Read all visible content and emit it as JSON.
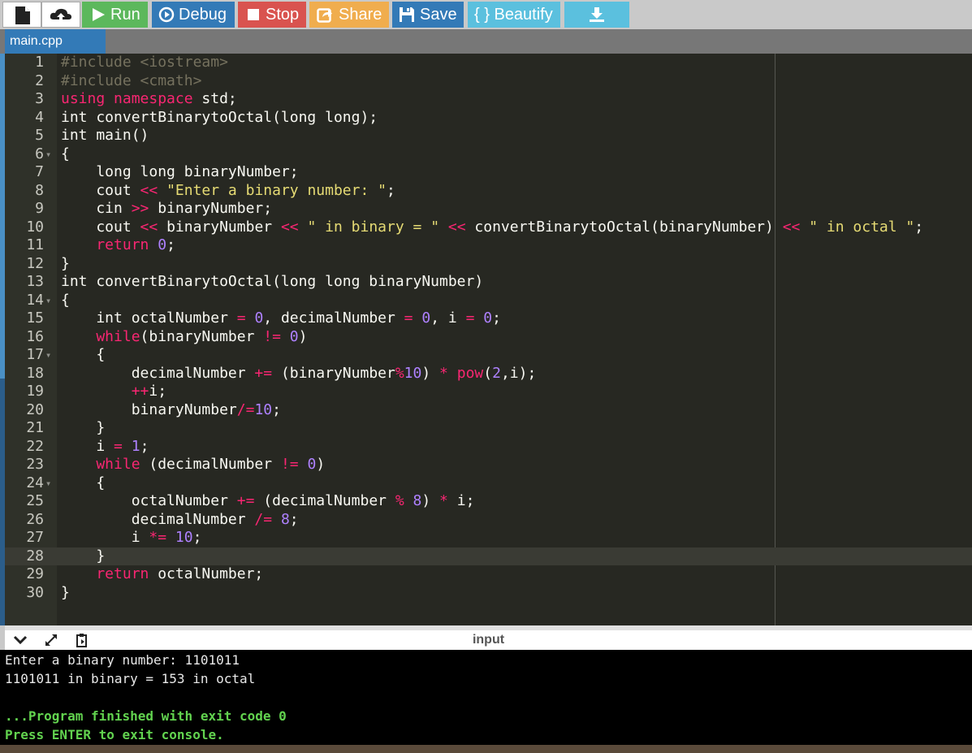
{
  "toolbar": {
    "buttons": [
      {
        "label": "Run",
        "icon": "play-icon",
        "color": "#5cb85c"
      },
      {
        "label": "Debug",
        "icon": "debug-circle-icon",
        "color": "#337ab7"
      },
      {
        "label": "Stop",
        "icon": "stop-square-icon",
        "color": "#d9534f"
      },
      {
        "label": "Share",
        "icon": "share-icon",
        "color": "#f0ad4e"
      },
      {
        "label": "Save",
        "icon": "floppy-disk-icon",
        "color": "#337ab7"
      },
      {
        "label": "{ } Beautify",
        "icon": "braces-icon",
        "color": "#5bc0de"
      },
      {
        "label": "",
        "icon": "download-icon",
        "color": "#5bc0de"
      }
    ]
  },
  "tab": {
    "label": "main.cpp"
  },
  "editor": {
    "active_line": 28,
    "lines": [
      {
        "n": "1",
        "fold": "",
        "parts": [
          [
            "inc",
            "#include "
          ],
          [
            "incf",
            "<iostream>"
          ]
        ]
      },
      {
        "n": "2",
        "fold": "",
        "parts": [
          [
            "inc",
            "#include "
          ],
          [
            "incf",
            "<cmath>"
          ]
        ]
      },
      {
        "n": "3",
        "fold": "",
        "parts": [
          [
            "ctl",
            "using namespace"
          ],
          [
            "kw",
            " std;"
          ]
        ]
      },
      {
        "n": "4",
        "fold": "",
        "parts": [
          [
            "kw",
            "int convertBinarytoOctal(long long);"
          ]
        ]
      },
      {
        "n": "5",
        "fold": "",
        "parts": [
          [
            "kw",
            "int main()"
          ]
        ]
      },
      {
        "n": "6",
        "fold": "▾",
        "parts": [
          [
            "kw",
            "{"
          ]
        ]
      },
      {
        "n": "7",
        "fold": "",
        "parts": [
          [
            "kw",
            "    long long binaryNumber;"
          ]
        ]
      },
      {
        "n": "8",
        "fold": "",
        "parts": [
          [
            "kw",
            "    cout "
          ],
          [
            "op",
            "<<"
          ],
          [
            "str",
            " \"Enter a binary number: \""
          ],
          [
            "kw",
            ";"
          ]
        ]
      },
      {
        "n": "9",
        "fold": "",
        "parts": [
          [
            "kw",
            "    cin "
          ],
          [
            "op",
            ">>"
          ],
          [
            "kw",
            " binaryNumber;"
          ]
        ]
      },
      {
        "n": "10",
        "fold": "",
        "parts": [
          [
            "kw",
            "    cout "
          ],
          [
            "op",
            "<<"
          ],
          [
            "kw",
            " binaryNumber "
          ],
          [
            "op",
            "<<"
          ],
          [
            "str",
            " \" in binary = \""
          ],
          [
            "kw",
            " "
          ],
          [
            "op",
            "<<"
          ],
          [
            "kw",
            " convertBinarytoOctal(binaryNumber) "
          ],
          [
            "op",
            "<<"
          ],
          [
            "str",
            " \" in octal \""
          ],
          [
            "kw",
            ";"
          ]
        ]
      },
      {
        "n": "11",
        "fold": "",
        "parts": [
          [
            "ctl",
            "    return "
          ],
          [
            "num",
            "0"
          ],
          [
            "kw",
            ";"
          ]
        ]
      },
      {
        "n": "12",
        "fold": "",
        "parts": [
          [
            "kw",
            "}"
          ]
        ]
      },
      {
        "n": "13",
        "fold": "",
        "parts": [
          [
            "kw",
            "int convertBinarytoOctal(long long binaryNumber)"
          ]
        ]
      },
      {
        "n": "14",
        "fold": "▾",
        "parts": [
          [
            "kw",
            "{"
          ]
        ]
      },
      {
        "n": "15",
        "fold": "",
        "parts": [
          [
            "kw",
            "    int octalNumber "
          ],
          [
            "op",
            "="
          ],
          [
            "kw",
            " "
          ],
          [
            "num",
            "0"
          ],
          [
            "kw",
            ", decimalNumber "
          ],
          [
            "op",
            "="
          ],
          [
            "kw",
            " "
          ],
          [
            "num",
            "0"
          ],
          [
            "kw",
            ", i "
          ],
          [
            "op",
            "="
          ],
          [
            "kw",
            " "
          ],
          [
            "num",
            "0"
          ],
          [
            "kw",
            ";"
          ]
        ]
      },
      {
        "n": "16",
        "fold": "",
        "parts": [
          [
            "ctl",
            "    while"
          ],
          [
            "kw",
            "(binaryNumber "
          ],
          [
            "op",
            "!="
          ],
          [
            "kw",
            " "
          ],
          [
            "num",
            "0"
          ],
          [
            "kw",
            ")"
          ]
        ]
      },
      {
        "n": "17",
        "fold": "▾",
        "parts": [
          [
            "kw",
            "    {"
          ]
        ]
      },
      {
        "n": "18",
        "fold": "",
        "parts": [
          [
            "kw",
            "        decimalNumber "
          ],
          [
            "op",
            "+="
          ],
          [
            "kw",
            " (binaryNumber"
          ],
          [
            "op",
            "%"
          ],
          [
            "num",
            "10"
          ],
          [
            "kw",
            ") "
          ],
          [
            "op",
            "*"
          ],
          [
            "kw",
            " "
          ],
          [
            "ctl",
            "pow"
          ],
          [
            "kw",
            "("
          ],
          [
            "num",
            "2"
          ],
          [
            "kw",
            ",i);"
          ]
        ]
      },
      {
        "n": "19",
        "fold": "",
        "parts": [
          [
            "op",
            "        ++"
          ],
          [
            "kw",
            "i;"
          ]
        ]
      },
      {
        "n": "20",
        "fold": "",
        "parts": [
          [
            "kw",
            "        binaryNumber"
          ],
          [
            "op",
            "/="
          ],
          [
            "num",
            "10"
          ],
          [
            "kw",
            ";"
          ]
        ]
      },
      {
        "n": "21",
        "fold": "",
        "parts": [
          [
            "kw",
            "    }"
          ]
        ]
      },
      {
        "n": "22",
        "fold": "",
        "parts": [
          [
            "kw",
            "    i "
          ],
          [
            "op",
            "="
          ],
          [
            "kw",
            " "
          ],
          [
            "num",
            "1"
          ],
          [
            "kw",
            ";"
          ]
        ]
      },
      {
        "n": "23",
        "fold": "",
        "parts": [
          [
            "ctl",
            "    while"
          ],
          [
            "kw",
            " (decimalNumber "
          ],
          [
            "op",
            "!="
          ],
          [
            "kw",
            " "
          ],
          [
            "num",
            "0"
          ],
          [
            "kw",
            ")"
          ]
        ]
      },
      {
        "n": "24",
        "fold": "▾",
        "parts": [
          [
            "kw",
            "    {"
          ]
        ]
      },
      {
        "n": "25",
        "fold": "",
        "parts": [
          [
            "kw",
            "        octalNumber "
          ],
          [
            "op",
            "+="
          ],
          [
            "kw",
            " (decimalNumber "
          ],
          [
            "op",
            "%"
          ],
          [
            "kw",
            " "
          ],
          [
            "num",
            "8"
          ],
          [
            "kw",
            ") "
          ],
          [
            "op",
            "*"
          ],
          [
            "kw",
            " i;"
          ]
        ]
      },
      {
        "n": "26",
        "fold": "",
        "parts": [
          [
            "kw",
            "        decimalNumber "
          ],
          [
            "op",
            "/="
          ],
          [
            "kw",
            " "
          ],
          [
            "num",
            "8"
          ],
          [
            "kw",
            ";"
          ]
        ]
      },
      {
        "n": "27",
        "fold": "",
        "parts": [
          [
            "kw",
            "        i "
          ],
          [
            "op",
            "*="
          ],
          [
            "kw",
            " "
          ],
          [
            "num",
            "10"
          ],
          [
            "kw",
            ";"
          ]
        ]
      },
      {
        "n": "28",
        "fold": "",
        "parts": [
          [
            "kw",
            "    }"
          ]
        ]
      },
      {
        "n": "29",
        "fold": "",
        "parts": [
          [
            "ctl",
            "    return"
          ],
          [
            "kw",
            " octalNumber;"
          ]
        ]
      },
      {
        "n": "30",
        "fold": "",
        "parts": [
          [
            "kw",
            "}"
          ]
        ]
      }
    ]
  },
  "console": {
    "title": "input",
    "lines": [
      {
        "text": "Enter a binary number: 1101011",
        "style": "normal"
      },
      {
        "text": "1101011 in binary = 153 in octal",
        "style": "normal"
      },
      {
        "text": "",
        "style": "normal"
      },
      {
        "text": "...Program finished with exit code 0",
        "style": "green"
      },
      {
        "text": "Press ENTER to exit console.",
        "style": "green"
      }
    ]
  }
}
